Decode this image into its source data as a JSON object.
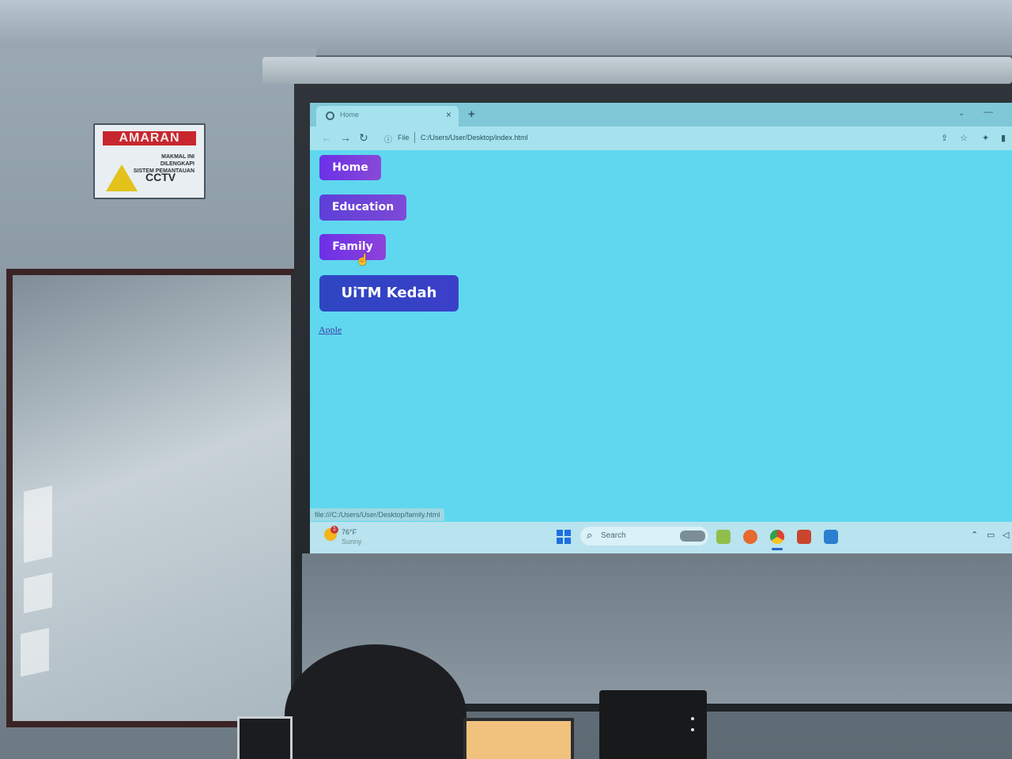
{
  "room": {
    "sign": {
      "title": "AMARAN",
      "text_line1": "MAKMAL INI DILENGKAPI",
      "text_line2": "SISTEM PEMANTAUAN",
      "cctv": "CCTV"
    }
  },
  "browser": {
    "tab": {
      "title": "Home",
      "close": "×",
      "new_tab": "+"
    },
    "window_controls": {
      "chevron": "⌄",
      "minimize": "—"
    },
    "nav": {
      "back": "←",
      "forward": "→",
      "reload": "↻"
    },
    "address": {
      "info_icon": "ⓘ",
      "scheme_label": "File",
      "url": "C:/Users/User/Desktop/index.html"
    },
    "toolbar_icons": {
      "share": "⇪",
      "bookmark": "☆",
      "extensions": "✦",
      "side_panel": "▮"
    },
    "status_url": "file:///C:/Users/User/Desktop/family.html"
  },
  "page": {
    "buttons": {
      "home": "Home",
      "education": "Education",
      "family": "Family",
      "uitm": "UiTM Kedah"
    },
    "link": "Apple"
  },
  "taskbar": {
    "weather": {
      "badge": "1",
      "temp": "76°F",
      "desc": "Sunny"
    },
    "search_icon": "⌕",
    "search_text": "Search",
    "tray": {
      "chevron_up": "⌃",
      "network": "▭",
      "volume": "◁"
    }
  },
  "colors": {
    "page_background": "#5fd8ef",
    "button_purple": "#6a31e8",
    "button_blue": "#2e46c2",
    "link": "#3d3fa8"
  }
}
